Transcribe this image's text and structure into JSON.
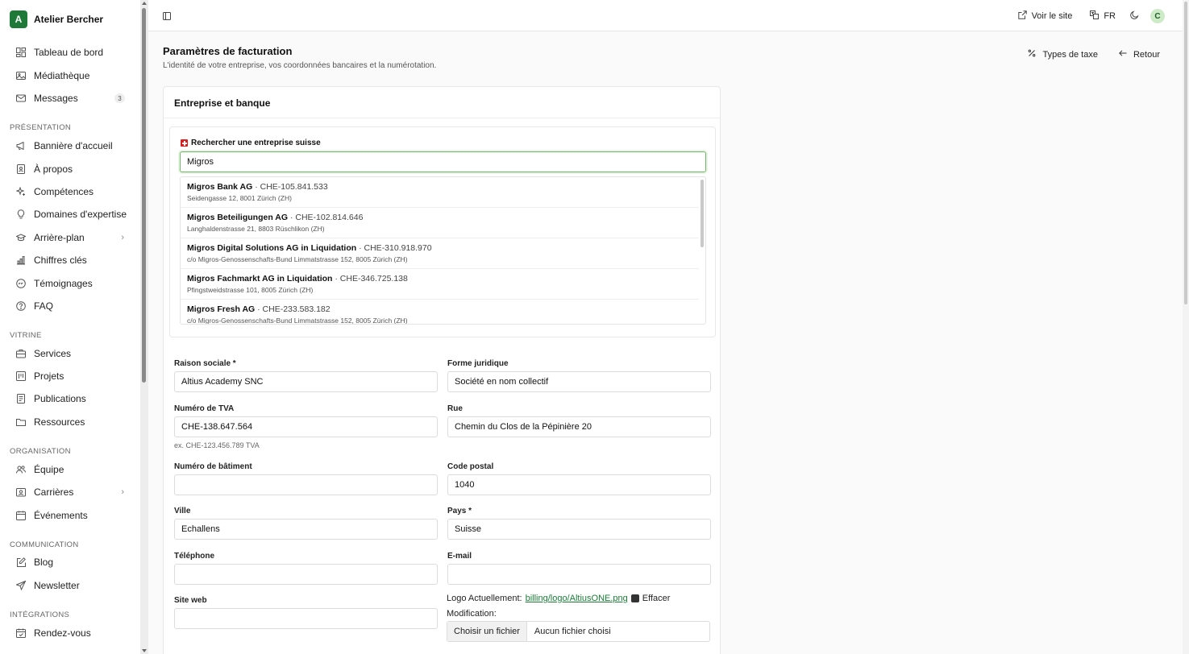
{
  "brand": {
    "initial": "A",
    "name": "Atelier Bercher"
  },
  "sidebar": {
    "top_items": [
      {
        "label": "Tableau de bord",
        "icon": "dashboard-icon"
      },
      {
        "label": "Médiathèque",
        "icon": "image-icon"
      },
      {
        "label": "Messages",
        "icon": "mail-icon",
        "badge": "3"
      }
    ],
    "sections": [
      {
        "label": "PRÉSENTATION",
        "items": [
          {
            "label": "Bannière d'accueil",
            "icon": "megaphone-icon"
          },
          {
            "label": "À propos",
            "icon": "id-card-icon"
          },
          {
            "label": "Compétences",
            "icon": "sparkles-icon"
          },
          {
            "label": "Domaines d'expertise",
            "icon": "lightbulb-icon"
          },
          {
            "label": "Arrière-plan",
            "icon": "graduation-cap-icon",
            "chevron": true
          },
          {
            "label": "Chiffres clés",
            "icon": "bar-chart-icon"
          },
          {
            "label": "Témoignages",
            "icon": "quote-icon"
          },
          {
            "label": "FAQ",
            "icon": "help-circle-icon"
          }
        ]
      },
      {
        "label": "VITRINE",
        "items": [
          {
            "label": "Services",
            "icon": "briefcase-icon"
          },
          {
            "label": "Projets",
            "icon": "kanban-icon"
          },
          {
            "label": "Publications",
            "icon": "document-icon"
          },
          {
            "label": "Ressources",
            "icon": "folder-icon"
          }
        ]
      },
      {
        "label": "ORGANISATION",
        "items": [
          {
            "label": "Équipe",
            "icon": "users-icon"
          },
          {
            "label": "Carrières",
            "icon": "badge-icon",
            "chevron": true
          },
          {
            "label": "Événements",
            "icon": "calendar-icon"
          }
        ]
      },
      {
        "label": "COMMUNICATION",
        "items": [
          {
            "label": "Blog",
            "icon": "pen-icon"
          },
          {
            "label": "Newsletter",
            "icon": "send-icon"
          }
        ]
      },
      {
        "label": "INTÉGRATIONS",
        "items": [
          {
            "label": "Rendez-vous",
            "icon": "calendar-check-icon"
          }
        ]
      }
    ]
  },
  "topbar": {
    "view_site": "Voir le site",
    "language": "FR",
    "avatar": "C"
  },
  "header": {
    "title": "Paramètres de facturation",
    "subtitle": "L'identité de votre entreprise, vos coordonnées bancaires et la numérotation.",
    "tax_types": "Types de taxe",
    "back": "Retour"
  },
  "card": {
    "title": "Entreprise et banque",
    "search": {
      "label": "Rechercher une entreprise suisse",
      "value": "Migros",
      "results": [
        {
          "name": "Migros Bank AG",
          "uid": " · CHE-105.841.533",
          "address": "Seidengasse 12, 8001 Zürich (ZH)"
        },
        {
          "name": "Migros Beteiligungen AG",
          "uid": " · CHE-102.814.646",
          "address": "Langhaldenstrasse 21, 8803 Rüschlikon (ZH)"
        },
        {
          "name": "Migros Digital Solutions AG in Liquidation",
          "uid": " · CHE-310.918.970",
          "address": "c/o Migros-Genossenschafts-Bund Limmatstrasse 152, 8005 Zürich (ZH)"
        },
        {
          "name": "Migros Fachmarkt AG in Liquidation",
          "uid": " · CHE-346.725.138",
          "address": "Pfingstweidstrasse 101, 8005 Zürich (ZH)"
        },
        {
          "name": "Migros Fresh AG",
          "uid": " · CHE-233.583.182",
          "address": "c/o Migros-Genossenschafts-Bund Limmatstrasse 152, 8005 Zürich (ZH)"
        }
      ]
    },
    "fields": {
      "raison_sociale": {
        "label": "Raison sociale *",
        "value": "Altius Academy SNC"
      },
      "forme_juridique": {
        "label": "Forme juridique",
        "value": "Société en nom collectif"
      },
      "tva": {
        "label": "Numéro de TVA",
        "value": "CHE-138.647.564",
        "hint": "ex. CHE-123.456.789 TVA"
      },
      "rue": {
        "label": "Rue",
        "value": "Chemin du Clos de la Pépinière 20"
      },
      "batiment": {
        "label": "Numéro de bâtiment",
        "value": ""
      },
      "code_postal": {
        "label": "Code postal",
        "value": "1040"
      },
      "ville": {
        "label": "Ville",
        "value": "Echallens"
      },
      "pays": {
        "label": "Pays *",
        "value": "Suisse"
      },
      "telephone": {
        "label": "Téléphone",
        "value": ""
      },
      "email": {
        "label": "E-mail",
        "value": ""
      },
      "site_web": {
        "label": "Site web",
        "value": ""
      }
    },
    "logo": {
      "current_prefix": "Logo Actuellement:",
      "file_link": "billing/logo/AltiusONE.png",
      "clear_label": "Effacer",
      "modification": "Modification:",
      "choose_button": "Choisir un fichier",
      "no_file": "Aucun fichier choisi"
    }
  }
}
